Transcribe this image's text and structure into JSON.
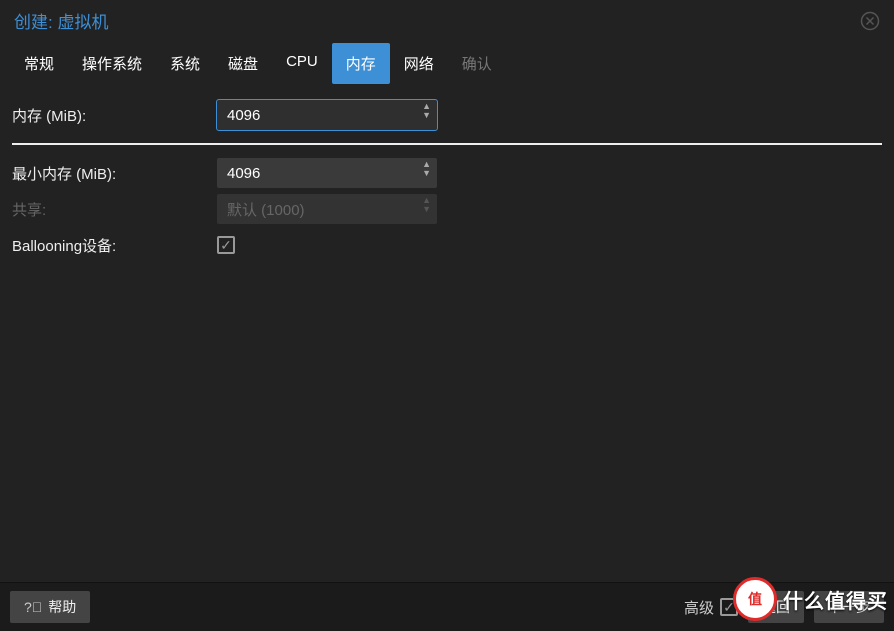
{
  "dialog": {
    "title": "创建: 虚拟机"
  },
  "tabs": [
    {
      "label": "常规",
      "active": false,
      "disabled": false
    },
    {
      "label": "操作系统",
      "active": false,
      "disabled": false
    },
    {
      "label": "系统",
      "active": false,
      "disabled": false
    },
    {
      "label": "磁盘",
      "active": false,
      "disabled": false
    },
    {
      "label": "CPU",
      "active": false,
      "disabled": false
    },
    {
      "label": "内存",
      "active": true,
      "disabled": false
    },
    {
      "label": "网络",
      "active": false,
      "disabled": false
    },
    {
      "label": "确认",
      "active": false,
      "disabled": true
    }
  ],
  "form": {
    "memory_label": "内存 (MiB):",
    "memory_value": "4096",
    "min_memory_label": "最小内存 (MiB):",
    "min_memory_value": "4096",
    "shares_label": "共享:",
    "shares_value": "默认 (1000)",
    "balloon_label": "Ballooning设备:",
    "balloon_checked": true
  },
  "footer": {
    "help_label": "帮助",
    "advanced_label": "高级",
    "advanced_checked": true,
    "back_label": "返回",
    "next_label": "下一步"
  },
  "watermark": {
    "badge": "值",
    "text": "什么值得买"
  }
}
